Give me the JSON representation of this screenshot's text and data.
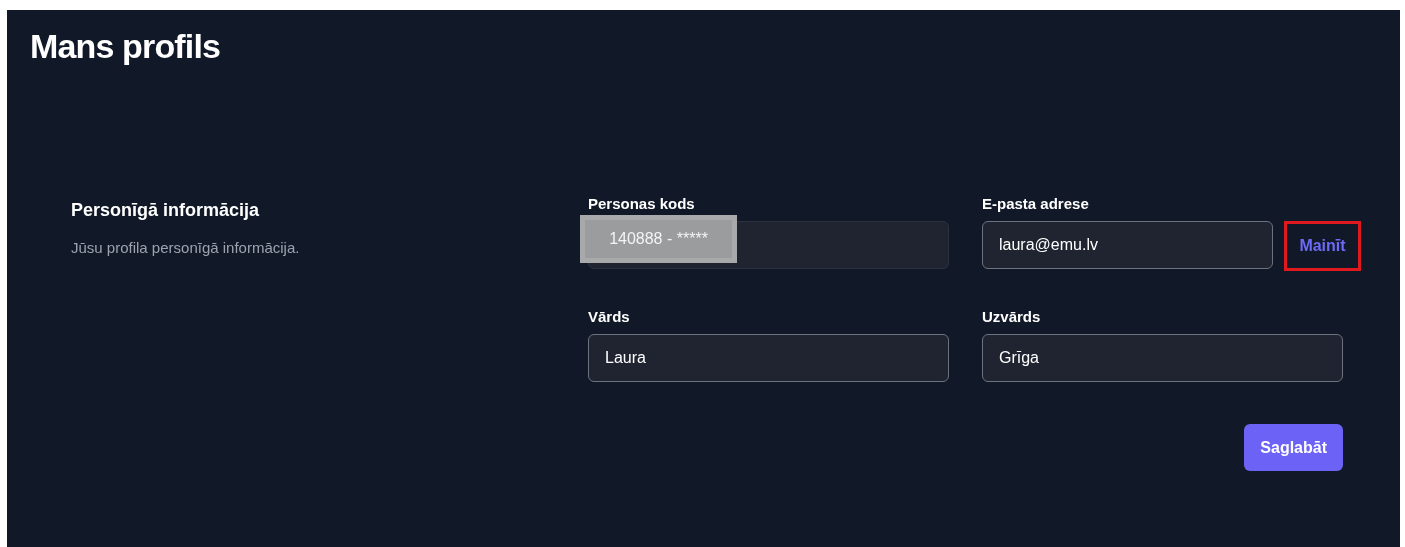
{
  "page": {
    "title": "Mans profils"
  },
  "section": {
    "title": "Personīgā informācija",
    "description": "Jūsu profila personīgā informācija."
  },
  "fields": [
    {
      "label": "Personas kods",
      "value": "140888 - *****",
      "disabled": true,
      "redacted": true
    },
    {
      "label": "E-pasta adrese",
      "value": "laura@emu.lv",
      "disabled": false,
      "redacted": false,
      "action": "Mainīt",
      "action_highlighted": true
    },
    {
      "label": "Vārds",
      "value": "Laura",
      "disabled": false,
      "redacted": false
    },
    {
      "label": "Uzvārds",
      "value": "Grīga",
      "disabled": false,
      "redacted": false
    }
  ],
  "save_button": "Saglabāt"
}
